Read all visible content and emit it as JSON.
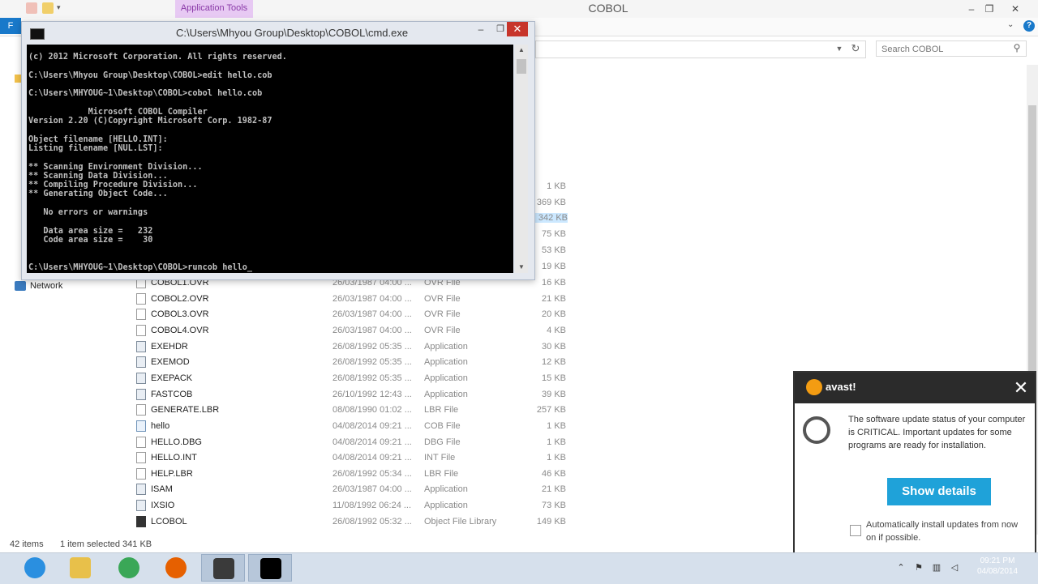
{
  "explorer": {
    "title": "COBOL",
    "context_tab": "Application Tools",
    "file_tab": "F",
    "search_placeholder": "Search COBOL",
    "help": "?",
    "window_controls": {
      "minimize": "–",
      "maximize": "❐",
      "close": "✕"
    }
  },
  "sidebar": {
    "network_label": "Network"
  },
  "file_list": {
    "top_sizes": [
      "1 KB",
      "369 KB",
      "342 KB",
      "75 KB",
      "53 KB",
      "19 KB"
    ],
    "rows": [
      {
        "name": "COBOL1.OVR",
        "date": "26/03/1987 04:00 ...",
        "type": "OVR File",
        "size": "16 KB",
        "icon": "file-icon"
      },
      {
        "name": "COBOL2.OVR",
        "date": "26/03/1987 04:00 ...",
        "type": "OVR File",
        "size": "21 KB",
        "icon": "file-icon"
      },
      {
        "name": "COBOL3.OVR",
        "date": "26/03/1987 04:00 ...",
        "type": "OVR File",
        "size": "20 KB",
        "icon": "file-icon"
      },
      {
        "name": "COBOL4.OVR",
        "date": "26/03/1987 04:00 ...",
        "type": "OVR File",
        "size": "4 KB",
        "icon": "file-icon"
      },
      {
        "name": "EXEHDR",
        "date": "26/08/1992 05:35 ...",
        "type": "Application",
        "size": "30 KB",
        "icon": "application-icon"
      },
      {
        "name": "EXEMOD",
        "date": "26/08/1992 05:35 ...",
        "type": "Application",
        "size": "12 KB",
        "icon": "application-icon"
      },
      {
        "name": "EXEPACK",
        "date": "26/08/1992 05:35 ...",
        "type": "Application",
        "size": "15 KB",
        "icon": "application-icon"
      },
      {
        "name": "FASTCOB",
        "date": "26/10/1992 12:43 ...",
        "type": "Application",
        "size": "39 KB",
        "icon": "application-icon"
      },
      {
        "name": "GENERATE.LBR",
        "date": "08/08/1990 01:02 ...",
        "type": "LBR File",
        "size": "257 KB",
        "icon": "file-icon"
      },
      {
        "name": "hello",
        "date": "04/08/2014 09:21 ...",
        "type": "COB File",
        "size": "1 KB",
        "icon": "cob-file-icon"
      },
      {
        "name": "HELLO.DBG",
        "date": "04/08/2014 09:21 ...",
        "type": "DBG File",
        "size": "1 KB",
        "icon": "file-icon"
      },
      {
        "name": "HELLO.INT",
        "date": "04/08/2014 09:21 ...",
        "type": "INT File",
        "size": "1 KB",
        "icon": "file-icon"
      },
      {
        "name": "HELP.LBR",
        "date": "26/08/1992 05:34 ...",
        "type": "LBR File",
        "size": "46 KB",
        "icon": "file-icon"
      },
      {
        "name": "ISAM",
        "date": "26/03/1987 04:00 ...",
        "type": "Application",
        "size": "21 KB",
        "icon": "application-icon"
      },
      {
        "name": "IXSIO",
        "date": "11/08/1992 06:24 ...",
        "type": "Application",
        "size": "73 KB",
        "icon": "application-icon"
      },
      {
        "name": "LCOBOL",
        "date": "26/08/1992 05:32 ...",
        "type": "Object File Library",
        "size": "149 KB",
        "icon": "library-icon"
      }
    ]
  },
  "status": {
    "item_count": "42 items",
    "selection": "1 item selected  341 KB"
  },
  "cmd": {
    "title": "C:\\Users\\Mhyou Group\\Desktop\\COBOL\\cmd.exe",
    "output": "(c) 2012 Microsoft Corporation. All rights reserved.\n\nC:\\Users\\Mhyou Group\\Desktop\\COBOL>edit hello.cob\n\nC:\\Users\\MHYOUG~1\\Desktop\\COBOL>cobol hello.cob\n\n            Microsoft COBOL Compiler\nVersion 2.20 (C)Copyright Microsoft Corp. 1982-87\n\nObject filename [HELLO.INT]:\nListing filename [NUL.LST]:\n\n** Scanning Environment Division...\n** Scanning Data Division...\n** Compiling Procedure Division...\n** Generating Object Code...\n\n   No errors or warnings\n\n   Data area size =   232\n   Code area size =    30\n\n\nC:\\Users\\MHYOUG~1\\Desktop\\COBOL>runcob hello_",
    "controls": {
      "minimize": "–",
      "maximize": "❐",
      "close": "✕"
    }
  },
  "avast": {
    "logo": "avast!",
    "message": "The software update status of your computer is CRITICAL. Important updates for some programs are ready for installation.",
    "button": "Show details",
    "checkbox_label": "Automatically install updates from now on if possible.",
    "close": "✕"
  },
  "taskbar": {
    "items": [
      {
        "name": "internet-explorer-icon",
        "color": "#2a8fe0"
      },
      {
        "name": "file-explorer-icon",
        "color": "#e8c04a"
      },
      {
        "name": "chrome-icon",
        "color": "#3aa757"
      },
      {
        "name": "firefox-icon",
        "color": "#e66000"
      },
      {
        "name": "app-icon",
        "color": "#3a3a3a"
      },
      {
        "name": "cmd-icon",
        "color": "#000000"
      }
    ],
    "clock_time": "09:21 PM",
    "clock_date": "04/08/2014"
  }
}
